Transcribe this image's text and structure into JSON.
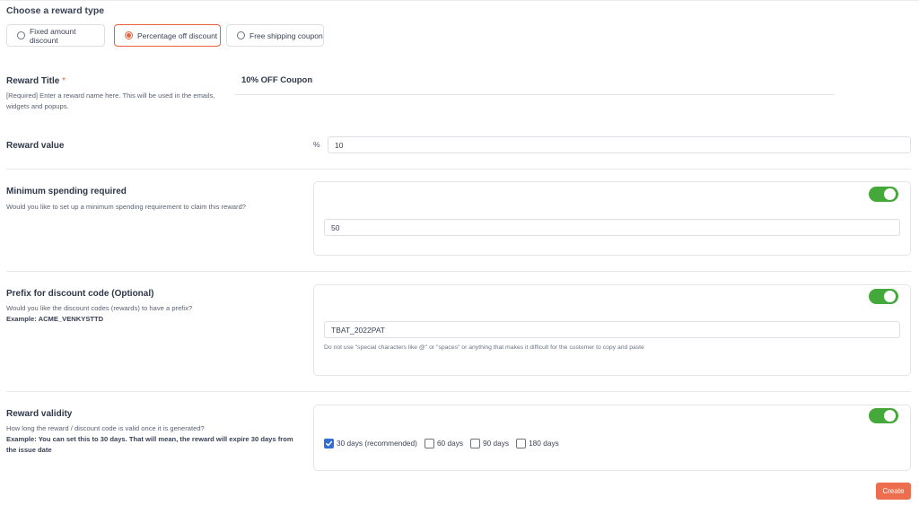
{
  "reward_type": {
    "heading": "Choose a reward type",
    "options": [
      {
        "label": "Fixed amount discount",
        "selected": false
      },
      {
        "label": "Percentage off discount",
        "selected": true
      },
      {
        "label": "Free shipping coupon",
        "selected": false
      }
    ]
  },
  "reward_title": {
    "label": "Reward Title",
    "required_mark": "*",
    "help": "[Required] Enter a reward name here. This will be used in the emails, widgets and popups.",
    "value": "10% OFF Coupon"
  },
  "reward_value": {
    "label": "Reward value",
    "unit": "%",
    "value": "10"
  },
  "min_spend": {
    "label": "Minimum spending required",
    "help": "Would you like to set up a minimum spending requirement to claim this reward?",
    "enabled": true,
    "value": "50"
  },
  "prefix": {
    "label": "Prefix for discount code (Optional)",
    "help": "Would you like the discount codes (rewards) to have a prefix?",
    "example": "Example: ACME_VENKYSTTD",
    "enabled": true,
    "value": "TBAT_2022PAT",
    "note": "Do not use \"special characters like @\" or \"spaces\" or anything that makes it difficult for the customer to copy and paste"
  },
  "validity": {
    "label": "Reward validity",
    "help": "How long the reward / discount code is valid once it is generated?",
    "example": "Example: You can set this to 30 days. That will mean, the reward will expire 30 days from the issue date",
    "enabled": true,
    "options": [
      {
        "label": "30 days (recommended)",
        "checked": true
      },
      {
        "label": "60 days",
        "checked": false
      },
      {
        "label": "90 days",
        "checked": false
      },
      {
        "label": "180 days",
        "checked": false
      }
    ]
  },
  "actions": {
    "create_label": "Create"
  },
  "colors": {
    "accent": "#e8623b",
    "toggle_on": "#45a83a",
    "checkbox_checked": "#2f6fd6",
    "create_button": "#ec6e4e"
  }
}
